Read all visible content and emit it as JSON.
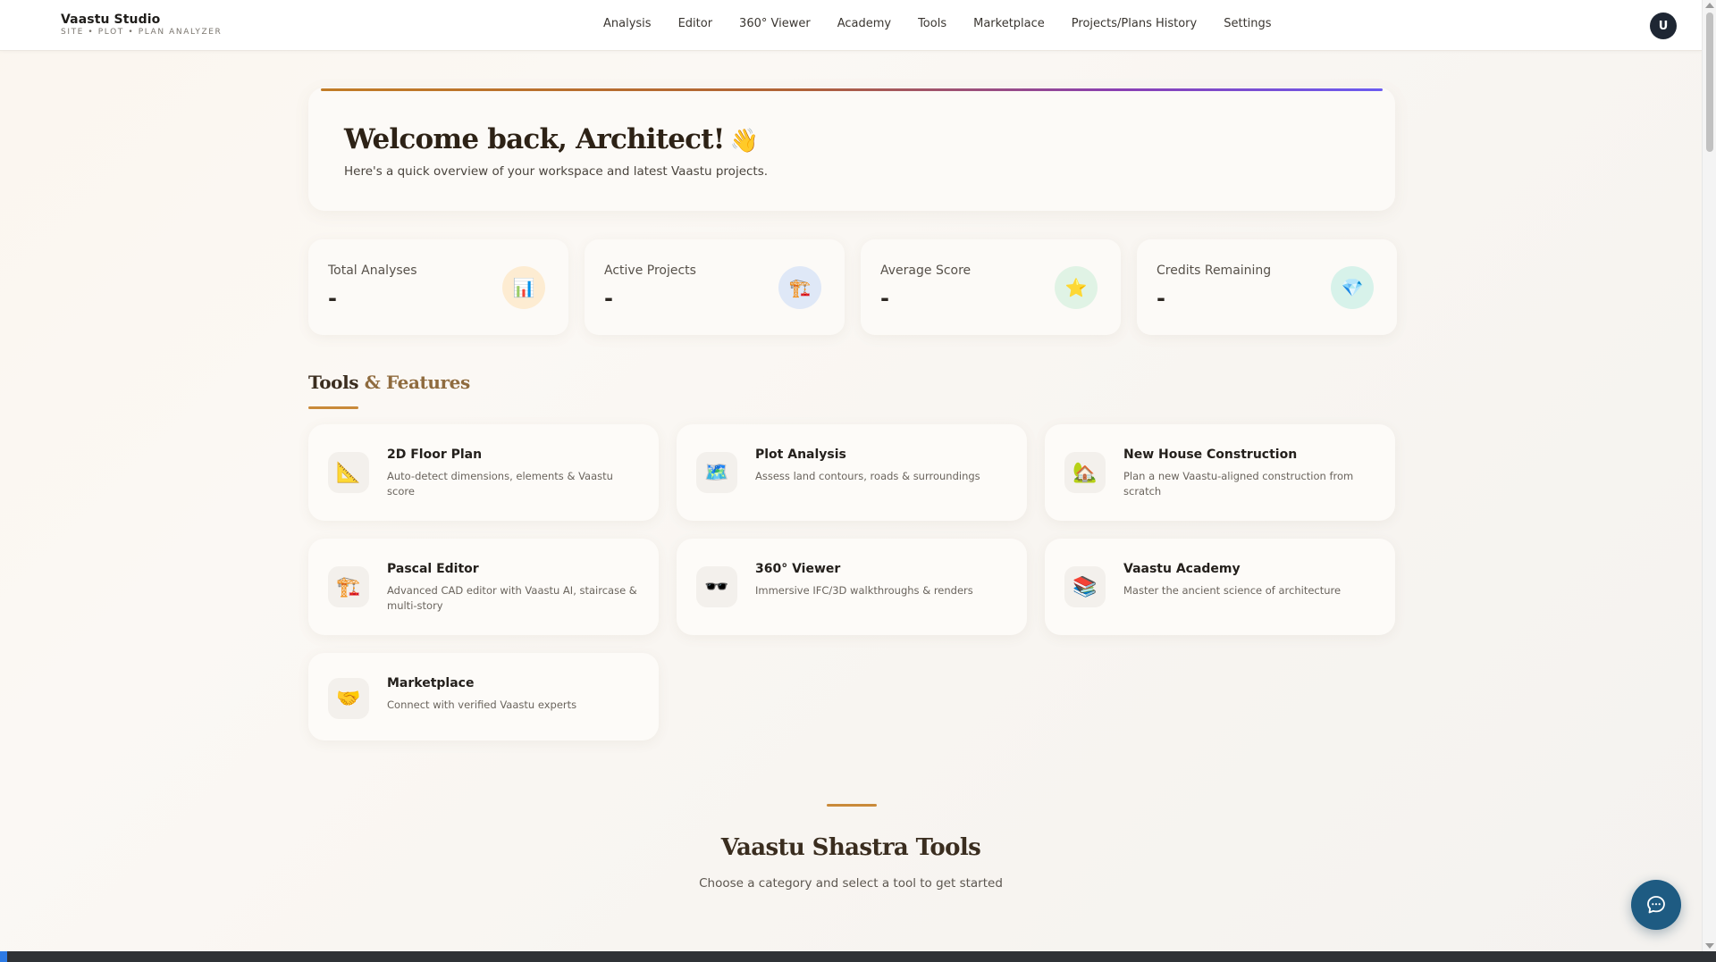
{
  "brand": {
    "title": "Vaastu Studio",
    "subtitle": "SITE • PLOT • PLAN ANALYZER"
  },
  "nav": {
    "items": [
      {
        "label": "Analysis"
      },
      {
        "label": "Editor"
      },
      {
        "label": "360° Viewer"
      },
      {
        "label": "Academy"
      },
      {
        "label": "Tools"
      },
      {
        "label": "Marketplace"
      },
      {
        "label": "Projects/Plans History"
      },
      {
        "label": "Settings"
      }
    ],
    "avatar_initial": "U"
  },
  "welcome": {
    "title": "Welcome back, Architect!",
    "emoji": "👋",
    "subtitle": "Here's a quick overview of your workspace and latest Vaastu projects."
  },
  "stats": [
    {
      "label": "Total Analyses",
      "value": "-",
      "icon": "bar-chart-icon",
      "glyph": "📊",
      "icon_bg": "#fdecd2"
    },
    {
      "label": "Active Projects",
      "value": "-",
      "icon": "construction-icon",
      "glyph": "🏗️",
      "icon_bg": "#dfe8f7"
    },
    {
      "label": "Average Score",
      "value": "-",
      "icon": "star-icon",
      "glyph": "⭐",
      "icon_bg": "#e0f3e5"
    },
    {
      "label": "Credits Remaining",
      "value": "-",
      "icon": "diamond-icon",
      "glyph": "💎",
      "icon_bg": "#d7f2ea"
    }
  ],
  "tools_section": {
    "title_part1": "Tools ",
    "title_amp": "&",
    "title_part2": " Features"
  },
  "tools": [
    {
      "title": "2D Floor Plan",
      "desc": "Auto-detect dimensions, elements & Vaastu score",
      "icon": "triangle-ruler-icon",
      "glyph": "📐"
    },
    {
      "title": "Plot Analysis",
      "desc": "Assess land contours, roads & surroundings",
      "icon": "map-icon",
      "glyph": "🗺️"
    },
    {
      "title": "New House Construction",
      "desc": "Plan a new Vaastu-aligned construction from scratch",
      "icon": "house-icon",
      "glyph": "🏡"
    },
    {
      "title": "Pascal Editor",
      "desc": "Advanced CAD editor with Vaastu AI, staircase & multi-story",
      "icon": "construction-icon",
      "glyph": "🏗️"
    },
    {
      "title": "360° Viewer",
      "desc": "Immersive IFC/3D walkthroughs & renders",
      "icon": "vr-glasses-icon",
      "glyph": "🕶️"
    },
    {
      "title": "Vaastu Academy",
      "desc": "Master the ancient science of architecture",
      "icon": "books-icon",
      "glyph": "📚"
    },
    {
      "title": "Marketplace",
      "desc": "Connect with verified Vaastu experts",
      "icon": "handshake-icon",
      "glyph": "🤝"
    }
  ],
  "shastra": {
    "title": "Vaastu Shastra Tools",
    "subtitle": "Choose a category and select a tool to get started"
  },
  "chat": {
    "icon": "chat-bubble-icon"
  }
}
